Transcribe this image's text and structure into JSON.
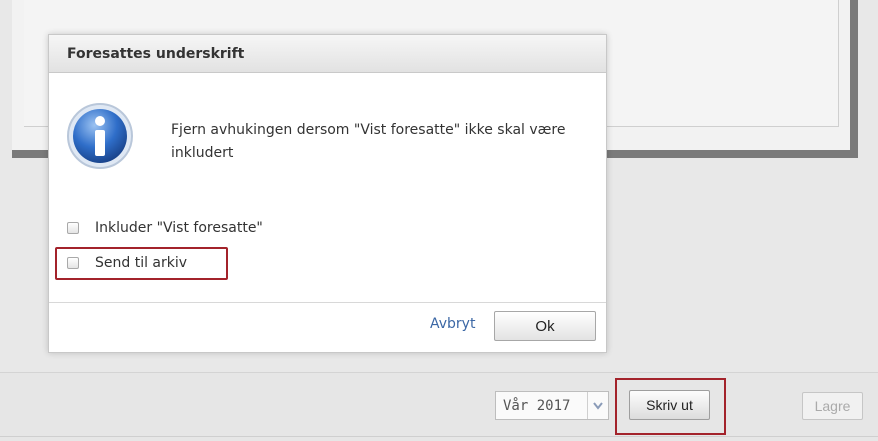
{
  "dialog": {
    "title": "Foresattes underskrift",
    "message": "Fjern avhukingen dersom \"Vist foresatte\" ikke skal være inkludert",
    "icon": "info-icon",
    "checkboxes": [
      {
        "label": "Inkluder \"Vist foresatte\"",
        "checked": false
      },
      {
        "label": "Send til arkiv",
        "checked": false,
        "highlighted": true
      }
    ],
    "cancel_label": "Avbryt",
    "ok_label": "Ok"
  },
  "footer": {
    "season_select": {
      "value": "Vår 2017"
    },
    "print_label": "Skriv ut",
    "save_label": "Lagre",
    "save_disabled": true
  },
  "colors": {
    "highlight": "#a3232b",
    "link": "#3b67a5",
    "info_icon": "#2f6ec9"
  }
}
